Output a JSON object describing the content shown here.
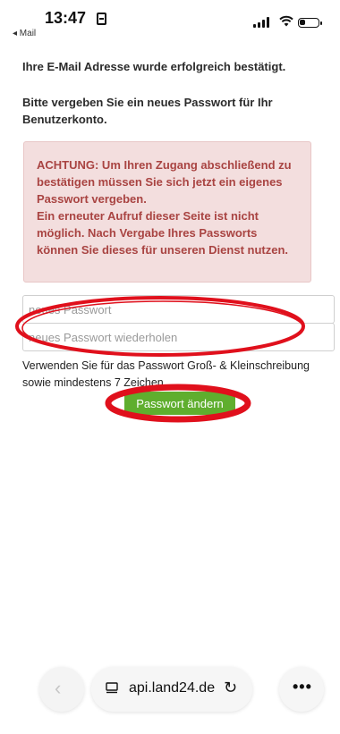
{
  "status_bar": {
    "time": "13:47",
    "back_app": "◂ Mail"
  },
  "main": {
    "confirm_text": "Ihre E-Mail Adresse wurde erfolgreich bestätigt.",
    "instruction_text": "Bitte vergeben Sie ein neues Passwort für Ihr Benutzerkonto.",
    "warning_lines": [
      "ACHTUNG: Um Ihren Zugang abschließend zu bestätigen müssen Sie sich jetzt ein eigenes Passwort vergeben.",
      "Ein erneuter Aufruf dieser Seite ist nicht möglich. Nach Vergabe Ihres Passworts können Sie dieses für unseren Dienst nutzen."
    ],
    "password_placeholder": "neues Passwort",
    "password_repeat_placeholder": "neues Passwort wiederholen",
    "hint_text": "Verwenden Sie für das Passwort Groß- & Kleinschreibung sowie mindestens 7 Zeichen",
    "submit_label": "Passwort ändern"
  },
  "browser_bar": {
    "url": "api.land24.de"
  },
  "colors": {
    "warning_bg": "#f3dede",
    "warning_text": "#a94442",
    "button_green": "#5fae2e",
    "annotation_red": "#e0101c"
  },
  "icons": {
    "back": "chevron-left-icon",
    "tabs": "tabs-icon",
    "reload": "reload-icon",
    "more": "more-icon",
    "signal": "signal-icon",
    "wifi": "wifi-icon",
    "battery": "battery-icon"
  }
}
